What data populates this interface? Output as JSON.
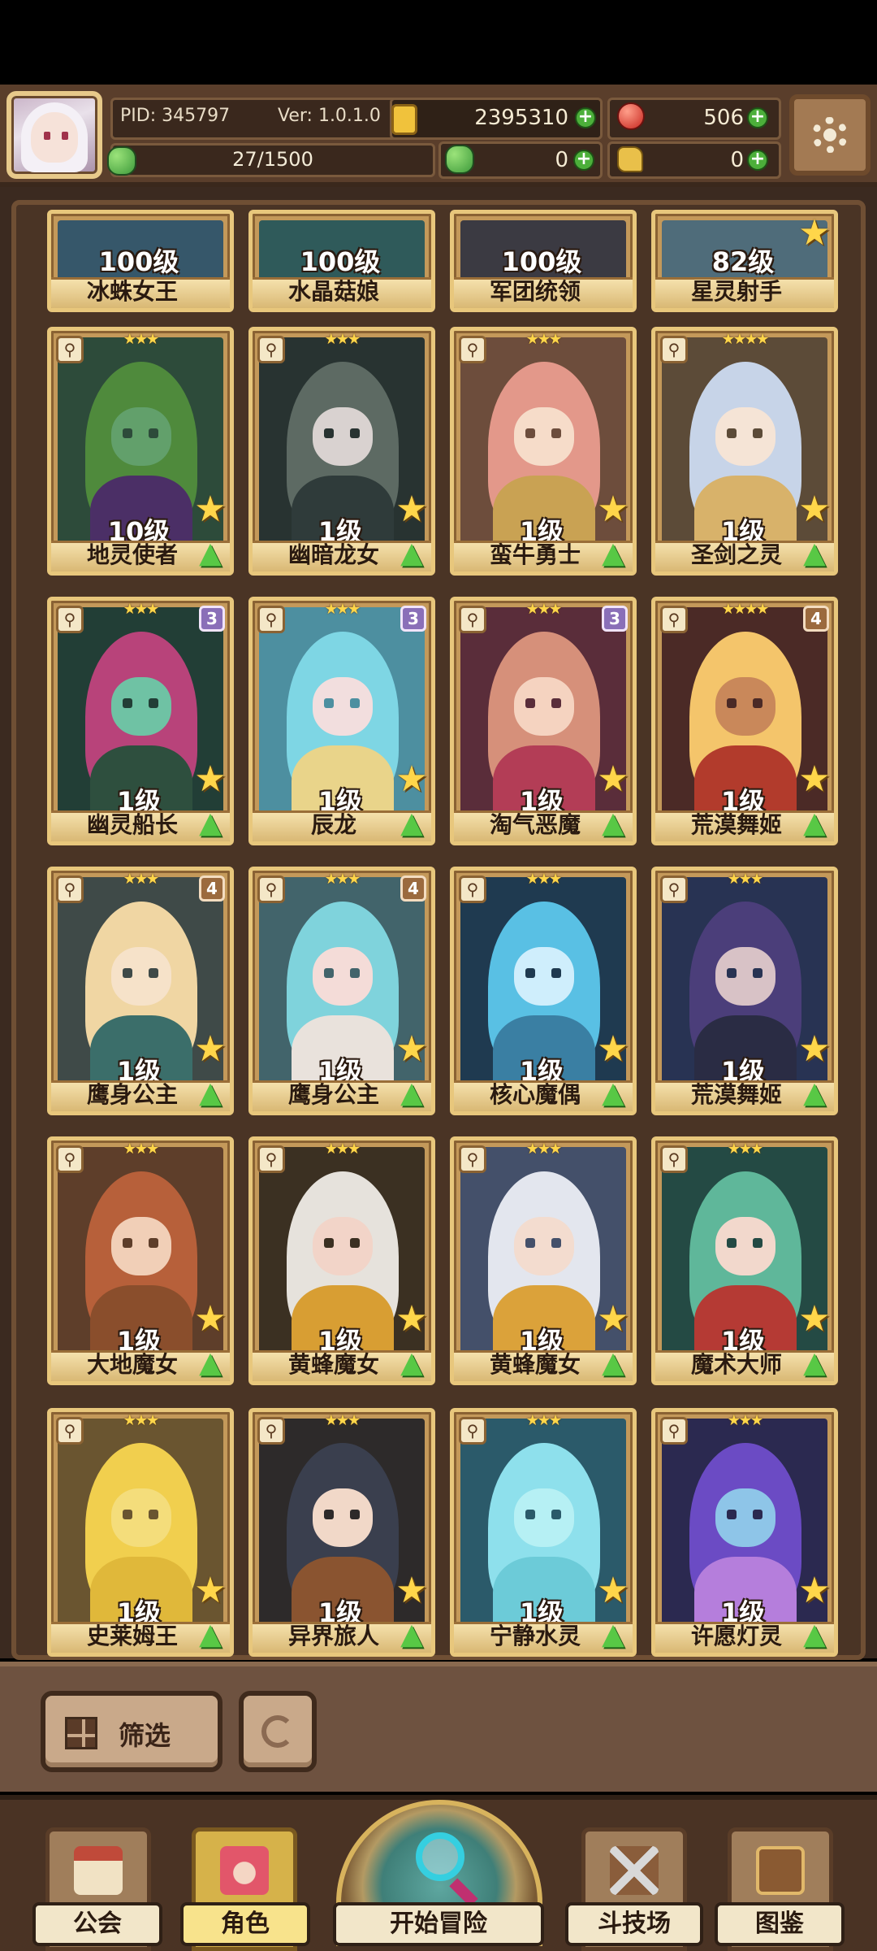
{
  "header": {
    "pid": "PID: 345797",
    "version": "Ver: 1.0.1.0",
    "exp": "27/1500",
    "gold": "2395310",
    "ruby": "506",
    "clover": "0",
    "glove": "0",
    "icons": {
      "avatar": "player-avatar",
      "gold": "coin-icon",
      "ruby": "ruby-icon",
      "clover": "clover-icon",
      "glove": "glove-icon",
      "settings": "gear-icon"
    }
  },
  "cards_partial": [
    {
      "level": "100级",
      "name": "冰蛛女王"
    },
    {
      "level": "100级",
      "name": "水晶菇娘"
    },
    {
      "level": "100级",
      "name": "军团统领"
    },
    {
      "level": "82级",
      "name": "星灵射手"
    }
  ],
  "cards": [
    {
      "level": "10级",
      "name": "地灵使者",
      "stars": "★★★",
      "badge": "",
      "palette": [
        "#2d4b3a",
        "#4f8a3c",
        "#62a06b",
        "#4b2f66"
      ]
    },
    {
      "level": "1级",
      "name": "幽暗龙女",
      "stars": "★★★",
      "badge": "",
      "palette": [
        "#283331",
        "#5d6a63",
        "#d9d2d0",
        "#2f3b3a"
      ]
    },
    {
      "level": "1级",
      "name": "蛮牛勇士",
      "stars": "★★★",
      "badge": "",
      "palette": [
        "#6d4d3c",
        "#e3988a",
        "#f6dcc9",
        "#c9a253"
      ]
    },
    {
      "level": "1级",
      "name": "圣剑之灵",
      "stars": "★★★★",
      "badge": "",
      "palette": [
        "#5c4b38",
        "#c7d4e8",
        "#f5e4d6",
        "#d8b26a"
      ]
    },
    {
      "level": "1级",
      "name": "幽灵船长",
      "stars": "★★★",
      "badge": "3",
      "palette": [
        "#223e36",
        "#b8437a",
        "#6fc2a4",
        "#2e4f3e"
      ]
    },
    {
      "level": "1级",
      "name": "辰龙",
      "stars": "★★★",
      "badge": "3",
      "palette": [
        "#4d8fa0",
        "#7ed6e4",
        "#f2dede",
        "#e9d48a"
      ]
    },
    {
      "level": "1级",
      "name": "淘气恶魔",
      "stars": "★★★",
      "badge": "3",
      "palette": [
        "#5a2d3a",
        "#d6907a",
        "#f5d3c0",
        "#b33d56"
      ]
    },
    {
      "level": "1级",
      "name": "荒漠舞姬",
      "stars": "★★★★",
      "badge": "4",
      "palette": [
        "#4b2a26",
        "#f4c56b",
        "#c9885a",
        "#b23b2c"
      ]
    },
    {
      "level": "1级",
      "name": "鹰身公主",
      "stars": "★★★",
      "badge": "4",
      "palette": [
        "#3f4a48",
        "#f0d6a3",
        "#f6e2c9",
        "#3b6e6a"
      ]
    },
    {
      "level": "1级",
      "name": "鹰身公主",
      "stars": "★★★",
      "badge": "4",
      "palette": [
        "#42646b",
        "#7fd3dc",
        "#f4dcd8",
        "#e9e2dc"
      ]
    },
    {
      "level": "1级",
      "name": "核心魔偶",
      "stars": "★★★",
      "badge": "",
      "palette": [
        "#1f3a50",
        "#59c0e4",
        "#cfeefc",
        "#3a7fa3"
      ]
    },
    {
      "level": "1级",
      "name": "荒漠舞姬",
      "stars": "★★★",
      "badge": "",
      "palette": [
        "#283353",
        "#4b3e7a",
        "#d8c2c6",
        "#2a2c44"
      ]
    },
    {
      "level": "1级",
      "name": "大地魔女",
      "stars": "★★★",
      "badge": "",
      "palette": [
        "#5e3e2a",
        "#b7603a",
        "#f1cfb7",
        "#8a4e2c"
      ]
    },
    {
      "level": "1级",
      "name": "黄蜂魔女",
      "stars": "★★★",
      "badge": "",
      "palette": [
        "#3b3022",
        "#e6e2dc",
        "#f2d4c8",
        "#d89e33"
      ]
    },
    {
      "level": "1级",
      "name": "黄蜂魔女",
      "stars": "★★★",
      "badge": "",
      "palette": [
        "#44506a",
        "#e3e6ee",
        "#f3dccf",
        "#dba23a"
      ]
    },
    {
      "level": "1级",
      "name": "魔术大师",
      "stars": "★★★",
      "badge": "",
      "palette": [
        "#244a44",
        "#5fb79a",
        "#f2d8cc",
        "#b53a34"
      ]
    },
    {
      "level": "1级",
      "name": "史莱姆王",
      "stars": "★★★",
      "badge": "",
      "palette": [
        "#6a5530",
        "#f1cf4e",
        "#f4dd7b",
        "#e0b83a"
      ]
    },
    {
      "level": "1级",
      "name": "异界旅人",
      "stars": "★★★",
      "badge": "",
      "palette": [
        "#2d2a2a",
        "#3a3f4e",
        "#f1d8c8",
        "#8a5430"
      ]
    },
    {
      "level": "1级",
      "name": "宁静水灵",
      "stars": "★★★",
      "badge": "",
      "palette": [
        "#2b5a6a",
        "#8ee0ec",
        "#b6f0f4",
        "#6ccbd8"
      ]
    },
    {
      "level": "1级",
      "name": "许愿灯灵",
      "stars": "★★★",
      "badge": "",
      "palette": [
        "#2b2950",
        "#6b4bc4",
        "#8ec5e8",
        "#b57edc"
      ]
    }
  ],
  "filter": {
    "label": "筛选"
  },
  "nav": {
    "guild": "公会",
    "character": "角色",
    "adventure": "开始冒险",
    "arena": "斗技场",
    "codex": "图鉴"
  },
  "colors": {
    "frame": "#e8c77c",
    "background": "#4a3425",
    "plus": "#4caf3a",
    "star": "#ffd64a"
  }
}
